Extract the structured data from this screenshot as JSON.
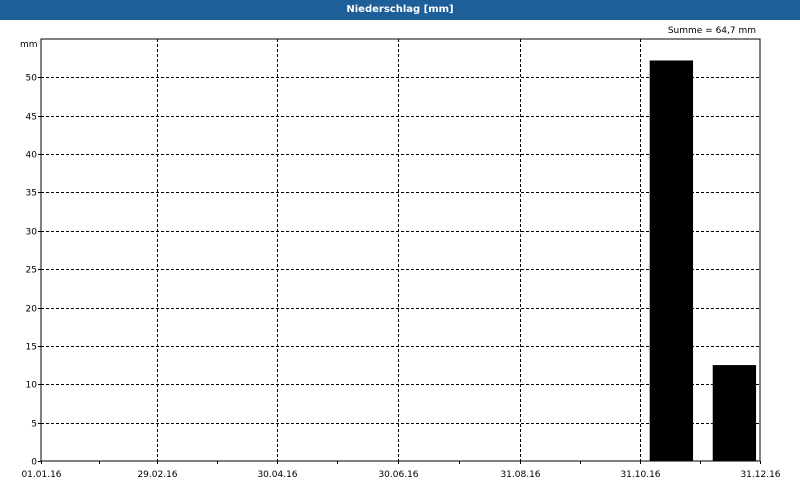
{
  "window": {
    "title": "Niederschlag [mm]"
  },
  "summary": {
    "text": "Summe = 64,7 mm"
  },
  "chart_data": {
    "type": "bar",
    "title": "Niederschlag [mm]",
    "ylabel": "mm",
    "xlabel": "",
    "ylim": [
      0,
      55
    ],
    "yticks": [
      0,
      5,
      10,
      15,
      20,
      25,
      30,
      35,
      40,
      45,
      50
    ],
    "xlim": [
      "2016-01-01",
      "2016-12-31"
    ],
    "xtick_labels": [
      "01.01.16",
      "29.02.16",
      "30.04.16",
      "30.06.16",
      "31.08.16",
      "31.10.16",
      "31.12.16"
    ],
    "xtick_dates": [
      "2016-01-01",
      "2016-02-29",
      "2016-04-30",
      "2016-06-30",
      "2016-08-31",
      "2016-10-31",
      "2016-12-31"
    ],
    "categories": [
      "2016-11",
      "2016-12"
    ],
    "bars": [
      {
        "start": "2016-11-05",
        "end": "2016-11-27",
        "value": 52.2
      },
      {
        "start": "2016-12-07",
        "end": "2016-12-29",
        "value": 12.5
      }
    ],
    "values": [
      52.2,
      12.5
    ],
    "grid": true,
    "bar_color": "#000000"
  }
}
